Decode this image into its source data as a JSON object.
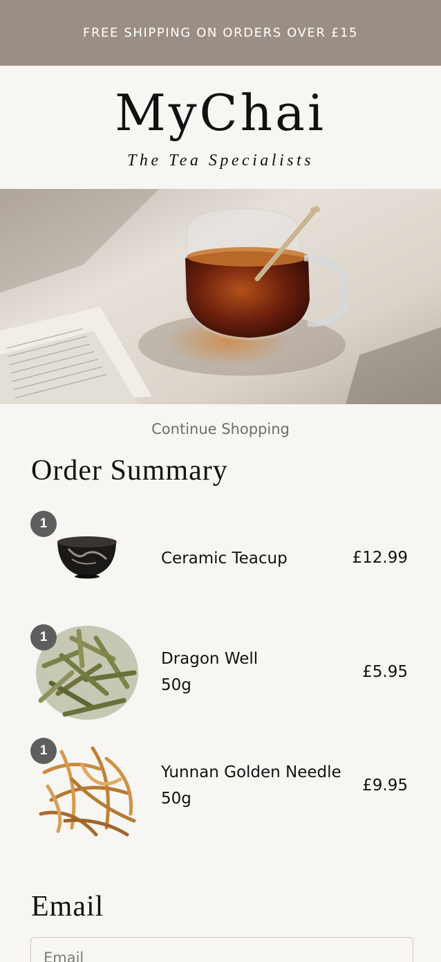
{
  "banner": {
    "text": "FREE SHIPPING ON ORDERS OVER £15"
  },
  "header": {
    "logo": "MyChai",
    "tagline": "The Tea Specialists"
  },
  "nav": {
    "continue_shopping": "Continue Shopping"
  },
  "order_summary": {
    "title": "Order Summary",
    "items": [
      {
        "qty": "1",
        "name": "Ceramic Teacup",
        "variant": "",
        "price": "£12.99",
        "thumb_icon": "teacup-image"
      },
      {
        "qty": "1",
        "name": "Dragon Well",
        "variant": "50g",
        "price": "£5.95",
        "thumb_icon": "green-tea-leaves-image"
      },
      {
        "qty": "1",
        "name": "Yunnan Golden Needle",
        "variant": "50g",
        "price": "£9.95",
        "thumb_icon": "golden-tea-leaves-image"
      }
    ]
  },
  "email": {
    "title": "Email",
    "placeholder": "Email"
  },
  "colors": {
    "banner_bg": "#9b8f85",
    "page_bg": "#f7f6f3",
    "badge_bg": "#5e5e5e"
  }
}
